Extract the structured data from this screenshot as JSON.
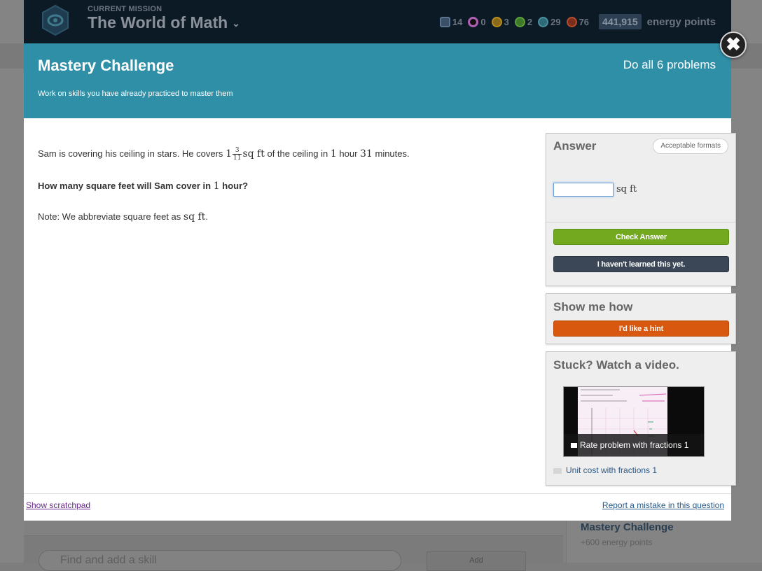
{
  "topbar": {
    "kicker": "CURRENT MISSION",
    "title": "The World of Math",
    "badges": [
      {
        "icon": "meteorite-badge-icon",
        "count": "14",
        "color": "#5a7391"
      },
      {
        "icon": "moon-badge-icon",
        "count": "0",
        "color": "#b15fb4"
      },
      {
        "icon": "earth-badge-icon",
        "count": "3",
        "color": "#b88c1d"
      },
      {
        "icon": "sun-badge-icon",
        "count": "2",
        "color": "#5aa03a"
      },
      {
        "icon": "black-hole-badge-icon",
        "count": "29",
        "color": "#4a8e9e"
      },
      {
        "icon": "challenge-badge-icon",
        "count": "76",
        "color": "#b84a2c"
      }
    ],
    "energy_points_value": "441,915",
    "energy_points_label": "energy points"
  },
  "modal": {
    "title": "Mastery Challenge",
    "subtitle": "Work on skills you have already practiced to master them",
    "count": "Do all 6 problems",
    "header_color": "#2f8fa7"
  },
  "problem": {
    "line1_a": "Sam is covering his ceiling in stars. He covers",
    "whole": "1",
    "frac_num": "3",
    "frac_den": "11",
    "unit1": "sq ft",
    "line1_b": "of the ceiling in",
    "hours": "1",
    "line1_c": "hour",
    "minutes": "31",
    "line1_d": "minutes.",
    "question_a": "How many square feet will Sam cover in",
    "question_num": "1",
    "question_b": "hour?",
    "note_a": "Note: We abbreviate square feet as",
    "note_unit": "sq ft",
    "note_b": "."
  },
  "answer_panel": {
    "title": "Answer",
    "formats_label": "Acceptable formats",
    "input_value": "",
    "unit": "sq ft",
    "check_label": "Check Answer",
    "skip_label": "I haven't learned this yet."
  },
  "hint_panel": {
    "title": "Show me how",
    "hint_label": "I'd like a hint"
  },
  "video_panel": {
    "title": "Stuck? Watch a video.",
    "video_title": "Rate problem with fractions 1",
    "link_label": "Unit cost with fractions 1"
  },
  "footer": {
    "scratchpad_label": "Show scratchpad",
    "report_label": "Report a mistake in this question"
  },
  "background": {
    "side_title": "Mastery Challenge",
    "side_sub": "+600 energy points",
    "search_placeholder": "Find and add a skill",
    "add_label": "Add"
  },
  "colors": {
    "check_button": "#72a91f",
    "skip_button": "#3b4756",
    "hint_button": "#d8580f"
  }
}
